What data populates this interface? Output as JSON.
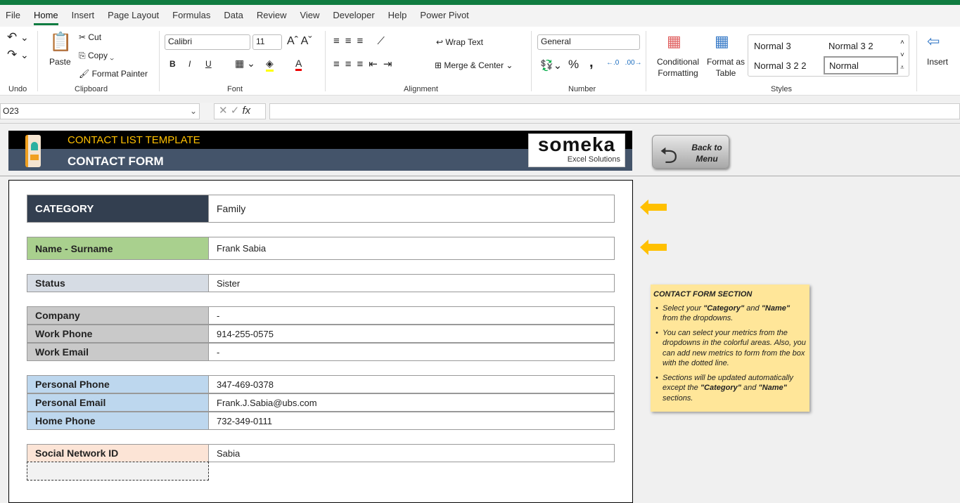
{
  "ribbon_tabs": [
    "File",
    "Home",
    "Insert",
    "Page Layout",
    "Formulas",
    "Data",
    "Review",
    "View",
    "Developer",
    "Help",
    "Power Pivot"
  ],
  "active_tab": "Home",
  "ribbon": {
    "groups": {
      "undo": "Undo",
      "clipboard": "Clipboard",
      "font": "Font",
      "alignment": "Alignment",
      "number": "Number",
      "styles": "Styles"
    },
    "paste": "Paste",
    "cut": "Cut",
    "copy": "Copy",
    "format_painter": "Format Painter",
    "font_name": "Calibri",
    "font_size": "11",
    "bold": "B",
    "italic": "I",
    "underline": "U",
    "wrap_text": "Wrap Text",
    "merge_center": "Merge & Center",
    "number_format": "General",
    "percent": "%",
    "comma": ",",
    "conditional_formatting": "Conditional Formatting",
    "format_as_table": "Format as Table",
    "styles": [
      "Normal 3",
      "Normal 3 2",
      "Normal 3 2 2",
      "Normal"
    ],
    "insert": "Insert"
  },
  "formula_bar": {
    "name_box": "O23",
    "fx": "fx",
    "value": ""
  },
  "banner": {
    "title": "CONTACT LIST TEMPLATE",
    "subtitle": "CONTACT FORM",
    "logo": "someka",
    "logo_sub": "Excel Solutions",
    "back_button": "Back to Menu"
  },
  "form": [
    {
      "label": "CATEGORY",
      "value": "Family",
      "color": "#333f50"
    },
    {
      "label": "Name - Surname",
      "value": "Frank Sabia",
      "color": "#a9d08e"
    },
    {
      "label": "Status",
      "value": "Sister",
      "color": "#d6dce4"
    },
    {
      "label": "Company",
      "value": "-",
      "color": "#c9c9c9"
    },
    {
      "label": "Work Phone",
      "value": "914-255-0575",
      "color": "#c9c9c9"
    },
    {
      "label": "Work Email",
      "value": "-",
      "color": "#c9c9c9"
    },
    {
      "label": "Personal Phone",
      "value": "347-469-0378",
      "color": "#bdd7ee"
    },
    {
      "label": "Personal Email",
      "value": "Frank.J.Sabia@ubs.com",
      "color": "#bdd7ee"
    },
    {
      "label": "Home Phone",
      "value": "732-349-0111",
      "color": "#bdd7ee"
    },
    {
      "label": "Social Network ID",
      "value": "Sabia",
      "color": "#fce4d6"
    }
  ],
  "note": {
    "title": "CONTACT FORM SECTION",
    "b1": [
      "Select your ",
      "\"Category\"",
      " and ",
      "\"Name\"",
      " from the dropdowns."
    ],
    "b2": "You can select your metrics from the dropdowns in the colorful areas. Also, you can add new metrics to form from the box with the dotted line.",
    "b3": [
      "Sections will be updated automatically except the ",
      "\"Category\"",
      " and ",
      "\"Name\"",
      " sections."
    ]
  },
  "colors": {
    "excel_green": "#107c41",
    "arrow": "#ffc000",
    "note_bg": "#ffe699",
    "banner_dark": "#44546a"
  }
}
